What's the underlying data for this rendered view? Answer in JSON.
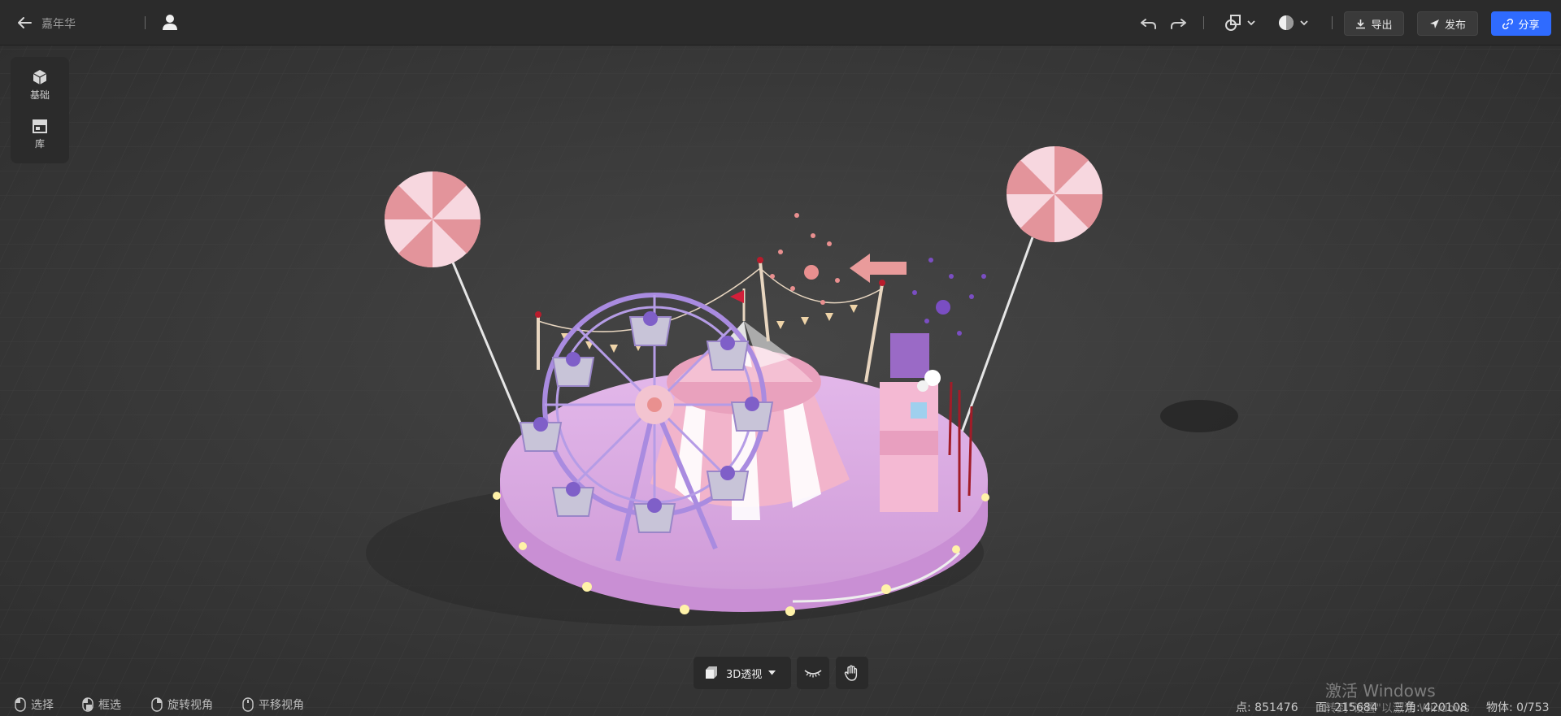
{
  "header": {
    "project_name": "嘉年华",
    "export_label": "导出",
    "publish_label": "发布",
    "share_label": "分享"
  },
  "left_panel": {
    "items": [
      {
        "label": "基础",
        "icon": "cube-icon"
      },
      {
        "label": "库",
        "icon": "store-icon"
      }
    ]
  },
  "view_toolbar": {
    "mode_label": "3D透视"
  },
  "status_bar": {
    "hints": [
      {
        "label": "选择",
        "icon": "mouse-left-icon"
      },
      {
        "label": "框选",
        "icon": "mouse-box-icon"
      },
      {
        "label": "旋转视角",
        "icon": "mouse-right-icon"
      },
      {
        "label": "平移视角",
        "icon": "mouse-middle-icon"
      }
    ],
    "stats": {
      "points": "点: 851476",
      "faces": "面: 215684",
      "triangles": "三角: 420108",
      "objects": "物体: 0/753"
    }
  },
  "watermark": {
    "line1": "激活 Windows",
    "line2": "转到\"设置\"以激活 Windows"
  },
  "colors": {
    "accent": "#2f6bff",
    "topbar": "#2b2b2b",
    "canvas": "#3a3a3a",
    "platform": "#d8a9e0",
    "pink": "#f3b9cf"
  }
}
